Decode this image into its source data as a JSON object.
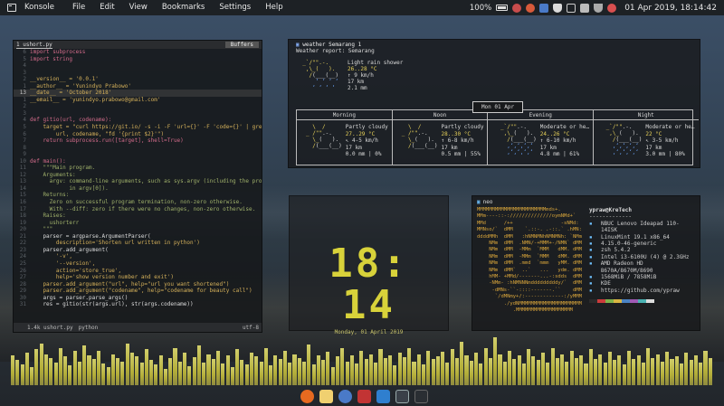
{
  "topbar": {
    "app_name": "Konsole",
    "menu": [
      "File",
      "Edit",
      "View",
      "Bookmarks",
      "Settings",
      "Help"
    ],
    "battery": "100%",
    "datetime": "01 Apr 2019, 18:14:42"
  },
  "editor": {
    "filename": "1 ushort.py",
    "buffers_label": "Buffers",
    "lines": [
      {
        "n": "6",
        "t": "import subprocess"
      },
      {
        "n": "5",
        "t": "import string"
      },
      {
        "n": "4",
        "t": ""
      },
      {
        "n": "3",
        "t": ""
      },
      {
        "n": "2",
        "t": "__version__ = '0.0.1'"
      },
      {
        "n": "1",
        "t": "__author__ = 'Yunindyo Prabowo'"
      },
      {
        "n": "13",
        "t": "__date__ = 'October 2018'"
      },
      {
        "n": "1",
        "t": "__email__ = 'yunindyo.prabowo@gmail.com'"
      },
      {
        "n": "2",
        "t": ""
      },
      {
        "n": "3",
        "t": ""
      },
      {
        "n": "4",
        "t": "def gitio(url, codename):"
      },
      {
        "n": "5",
        "t": "    target = \"curl https://git.io/ -s -i -F 'url={}' -F 'code={}' | gre"
      },
      {
        "n": "6",
        "t": "        url, codename, \"fd '{print $2}'\")"
      },
      {
        "n": "7",
        "t": "    return subprocess.run([target], shell=True)"
      },
      {
        "n": "8",
        "t": ""
      },
      {
        "n": "9",
        "t": ""
      },
      {
        "n": "10",
        "t": "def main():"
      },
      {
        "n": "11",
        "t": "    \"\"\"Main program."
      },
      {
        "n": "12",
        "t": "    Arguments:"
      },
      {
        "n": "13",
        "t": "      argv: command-line arguments, such as sys.argv (including the progr"
      },
      {
        "n": "14",
        "t": "            in argv[0])."
      },
      {
        "n": "15",
        "t": "    Returns:"
      },
      {
        "n": "16",
        "t": "      Zero on successful program termination, non-zero otherwise."
      },
      {
        "n": "17",
        "t": "      With --diff: zero if there were no changes, non-zero otherwise."
      },
      {
        "n": "18",
        "t": "    Raises:"
      },
      {
        "n": "19",
        "t": "      ushorterr"
      },
      {
        "n": "20",
        "t": "    \"\"\""
      },
      {
        "n": "21",
        "t": "    parser = argparse.ArgumentParser("
      },
      {
        "n": "22",
        "t": "        description='Shorten url written in python')"
      },
      {
        "n": "23",
        "t": "    parser.add_argument("
      },
      {
        "n": "24",
        "t": "        '-v',"
      },
      {
        "n": "25",
        "t": "        '--version',"
      },
      {
        "n": "26",
        "t": "        action='store_true',"
      },
      {
        "n": "27",
        "t": "        help='show version number and exit')"
      },
      {
        "n": "28",
        "t": "    parser.add_argument(\"url\", help=\"url you want shortened\")"
      },
      {
        "n": "29",
        "t": "    parser.add_argument(\"codename\", help=\"codename for beauty call\")"
      },
      {
        "n": "30",
        "t": "    args = parser.parse_args()"
      },
      {
        "n": "31",
        "t": "    res = gitio(str(args.url), str(args.codename))"
      }
    ],
    "status_mode": "",
    "status_file": "1.4k ushort.py",
    "status_lang": "python",
    "status_enc": "utf-8"
  },
  "weather": {
    "title": "weather Semarang 1",
    "report": "Weather report: Semarang",
    "now": {
      "desc": "Light rain shower",
      "temp": "26..28 °C",
      "wind": "↑ 9 km/h",
      "vis": "17 km",
      "precip": "2.1 mm"
    },
    "date": "Mon 01 Apr",
    "periods": [
      {
        "name": "Morning",
        "desc": "Partly cloudy",
        "temp": "27..29 °C",
        "wind": "↖ 4-5 km/h",
        "vis": "17 km",
        "precip": "0.0 mm | 0%"
      },
      {
        "name": "Noon",
        "desc": "Partly cloudy",
        "temp": "28..30 °C",
        "wind": "↑ 6-8 km/h",
        "vis": "17 km",
        "precip": "0.5 mm | 55%"
      },
      {
        "name": "Evening",
        "desc": "Moderate or he…",
        "temp": "24..26 °C",
        "wind": "↑ 6-10 km/h",
        "vis": "17 km",
        "precip": "4.8 mm | 61%"
      },
      {
        "name": "Night",
        "desc": "Moderate or he…",
        "temp": "22 °C",
        "wind": "↖ 3-5 km/h",
        "vis": "17 km",
        "precip": "3.0 mm | 80%"
      }
    ]
  },
  "clock": {
    "time": "18: 14",
    "date": "Monday, 01 April 2019"
  },
  "neofetch": {
    "title": "neo",
    "user": "ypraw@KreTech",
    "sep": "-------------",
    "info": [
      "NBUC Lenovo Ideapad 110-14ISK",
      "LinuxMint 19.1 x86_64",
      "4.15.0-46-generic",
      "zsh 5.4.2",
      "Intel i3-6100U (4) @ 2.3GHz",
      "AMD Radeon HD 8670A/8670M/8690",
      "1568MiB / 7858MiB",
      "KDE",
      "https://github.com/ypraw"
    ],
    "swatches": [
      "#2b2b2b",
      "#cc3b3b",
      "#7fb24a",
      "#d9b542",
      "#4a82c2",
      "#a05ab4",
      "#4ab2b2",
      "#dddddd"
    ]
  },
  "equalizer": {
    "levels": [
      0.5,
      0.42,
      0.35,
      0.55,
      0.3,
      0.6,
      0.7,
      0.52,
      0.45,
      0.38,
      0.62,
      0.48,
      0.33,
      0.57,
      0.4,
      0.66,
      0.5,
      0.44,
      0.58,
      0.36,
      0.3,
      0.52,
      0.46,
      0.4,
      0.7,
      0.55,
      0.48,
      0.38,
      0.6,
      0.42,
      0.35,
      0.5,
      0.28,
      0.45,
      0.62,
      0.4,
      0.54,
      0.32,
      0.47,
      0.66,
      0.38,
      0.52,
      0.44,
      0.58,
      0.36,
      0.5,
      0.3,
      0.6,
      0.42,
      0.35,
      0.55,
      0.48,
      0.4,
      0.62,
      0.34,
      0.5,
      0.44,
      0.58,
      0.38,
      0.52,
      0.46,
      0.4,
      0.68,
      0.35,
      0.5,
      0.42,
      0.56,
      0.3,
      0.48,
      0.62,
      0.4,
      0.5,
      0.36,
      0.58,
      0.44,
      0.52,
      0.38,
      0.6,
      0.45,
      0.5,
      0.33,
      0.55,
      0.47,
      0.62,
      0.4,
      0.52,
      0.35,
      0.58,
      0.44,
      0.49,
      0.56,
      0.38,
      0.6,
      0.45,
      0.72,
      0.5,
      0.41,
      0.55,
      0.36,
      0.62,
      0.46,
      0.8,
      0.52,
      0.4,
      0.58,
      0.44,
      0.5,
      0.36,
      0.6,
      0.48,
      0.42,
      0.55,
      0.38,
      0.62,
      0.46,
      0.52,
      0.4,
      0.58,
      0.45,
      0.5,
      0.36,
      0.6,
      0.44,
      0.52,
      0.38,
      0.56,
      0.42,
      0.5,
      0.35,
      0.58,
      0.44,
      0.5,
      0.38,
      0.62,
      0.46,
      0.52,
      0.4,
      0.56,
      0.44,
      0.48,
      0.36,
      0.55,
      0.42,
      0.5,
      0.38,
      0.58,
      0.45
    ]
  },
  "dock": {
    "icons": [
      {
        "name": "firefox-icon",
        "color": "#e66a20"
      },
      {
        "name": "files-icon",
        "color": "#f0d070"
      },
      {
        "name": "thunderbird-icon",
        "color": "#4a7ac8"
      },
      {
        "name": "mendeley-icon",
        "color": "#c23434"
      },
      {
        "name": "vscode-icon",
        "color": "#2f7fcf"
      },
      {
        "name": "terminal-icon",
        "color": "#3a4048"
      },
      {
        "name": "kate-icon",
        "color": "#2a2e33"
      }
    ]
  }
}
